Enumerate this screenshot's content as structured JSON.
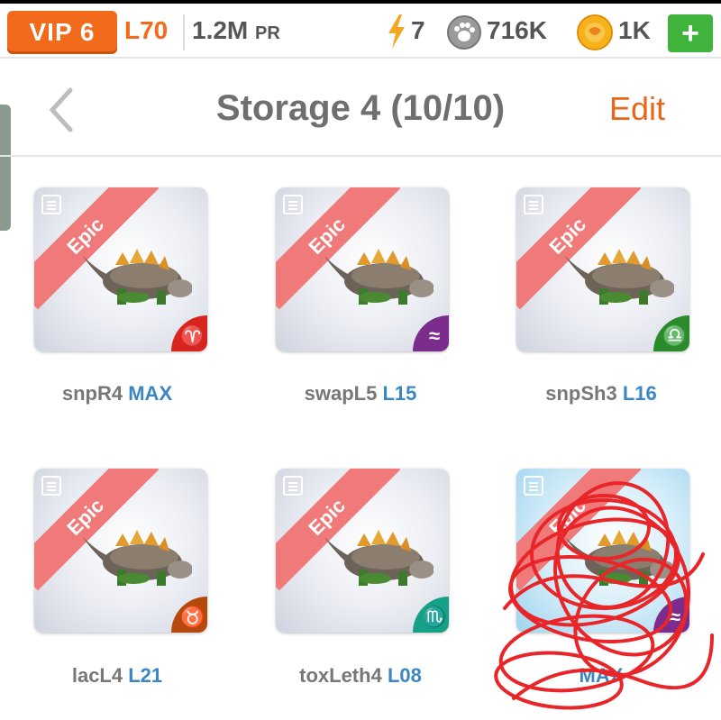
{
  "status": {
    "vip": "VIP 6",
    "level": "L70",
    "power": "1.2M",
    "power_unit": "PR",
    "energy": "7",
    "food": "716K",
    "coins": "1K",
    "add": "+"
  },
  "header": {
    "title": "Storage 4 (10/10)",
    "edit": "Edit"
  },
  "cards": [
    {
      "rarity": "Epic",
      "name": "snpR4",
      "level": "MAX",
      "sign_color": "#d7241f",
      "sign": "♈"
    },
    {
      "rarity": "Epic",
      "name": "swapL5",
      "level": "L15",
      "sign_color": "#7b2c8c",
      "sign": "≈"
    },
    {
      "rarity": "Epic",
      "name": "snpSh3",
      "level": "L16",
      "sign_color": "#2b8a2b",
      "sign": "♎"
    },
    {
      "rarity": "Epic",
      "name": "lacL4",
      "level": "L21",
      "sign_color": "#b5480c",
      "sign": "♉"
    },
    {
      "rarity": "Epic",
      "name": "toxLeth4",
      "level": "L08",
      "sign_color": "#16a085",
      "sign": "♏"
    },
    {
      "rarity": "Epic",
      "name": "",
      "level": "MAX",
      "sign_color": "#7b2c8c",
      "sign": "≈"
    }
  ],
  "icons": {
    "back": "chevron-left-icon",
    "energy": "lightning-bolt-icon",
    "food": "paw-icon",
    "coins": "coin-icon",
    "card_info": "document-icon"
  },
  "colors": {
    "accent": "#f26b1d",
    "level_blue": "#3b86c4",
    "ribbon": "#f07a7a",
    "plus_green": "#3fb33c"
  }
}
